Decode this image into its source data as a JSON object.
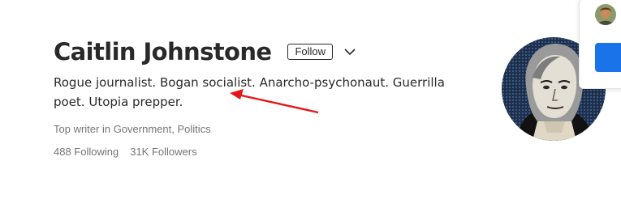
{
  "profile": {
    "name": "Caitlin Johnstone",
    "follow_label": "Follow",
    "bio": "Rogue journalist. Bogan socialist. Anarcho-psychonaut. Guerrilla poet. Utopia prepper.",
    "top_writer": "Top writer in Government, Politics",
    "following": "488 Following",
    "followers": "31K Followers"
  },
  "icons": {
    "more": "chevron-down-icon",
    "annotation": "red-arrow-icon"
  },
  "colors": {
    "text": "#292929",
    "muted": "#757575",
    "annotation": "#e8141b",
    "popover_button": "#1a73e8"
  }
}
